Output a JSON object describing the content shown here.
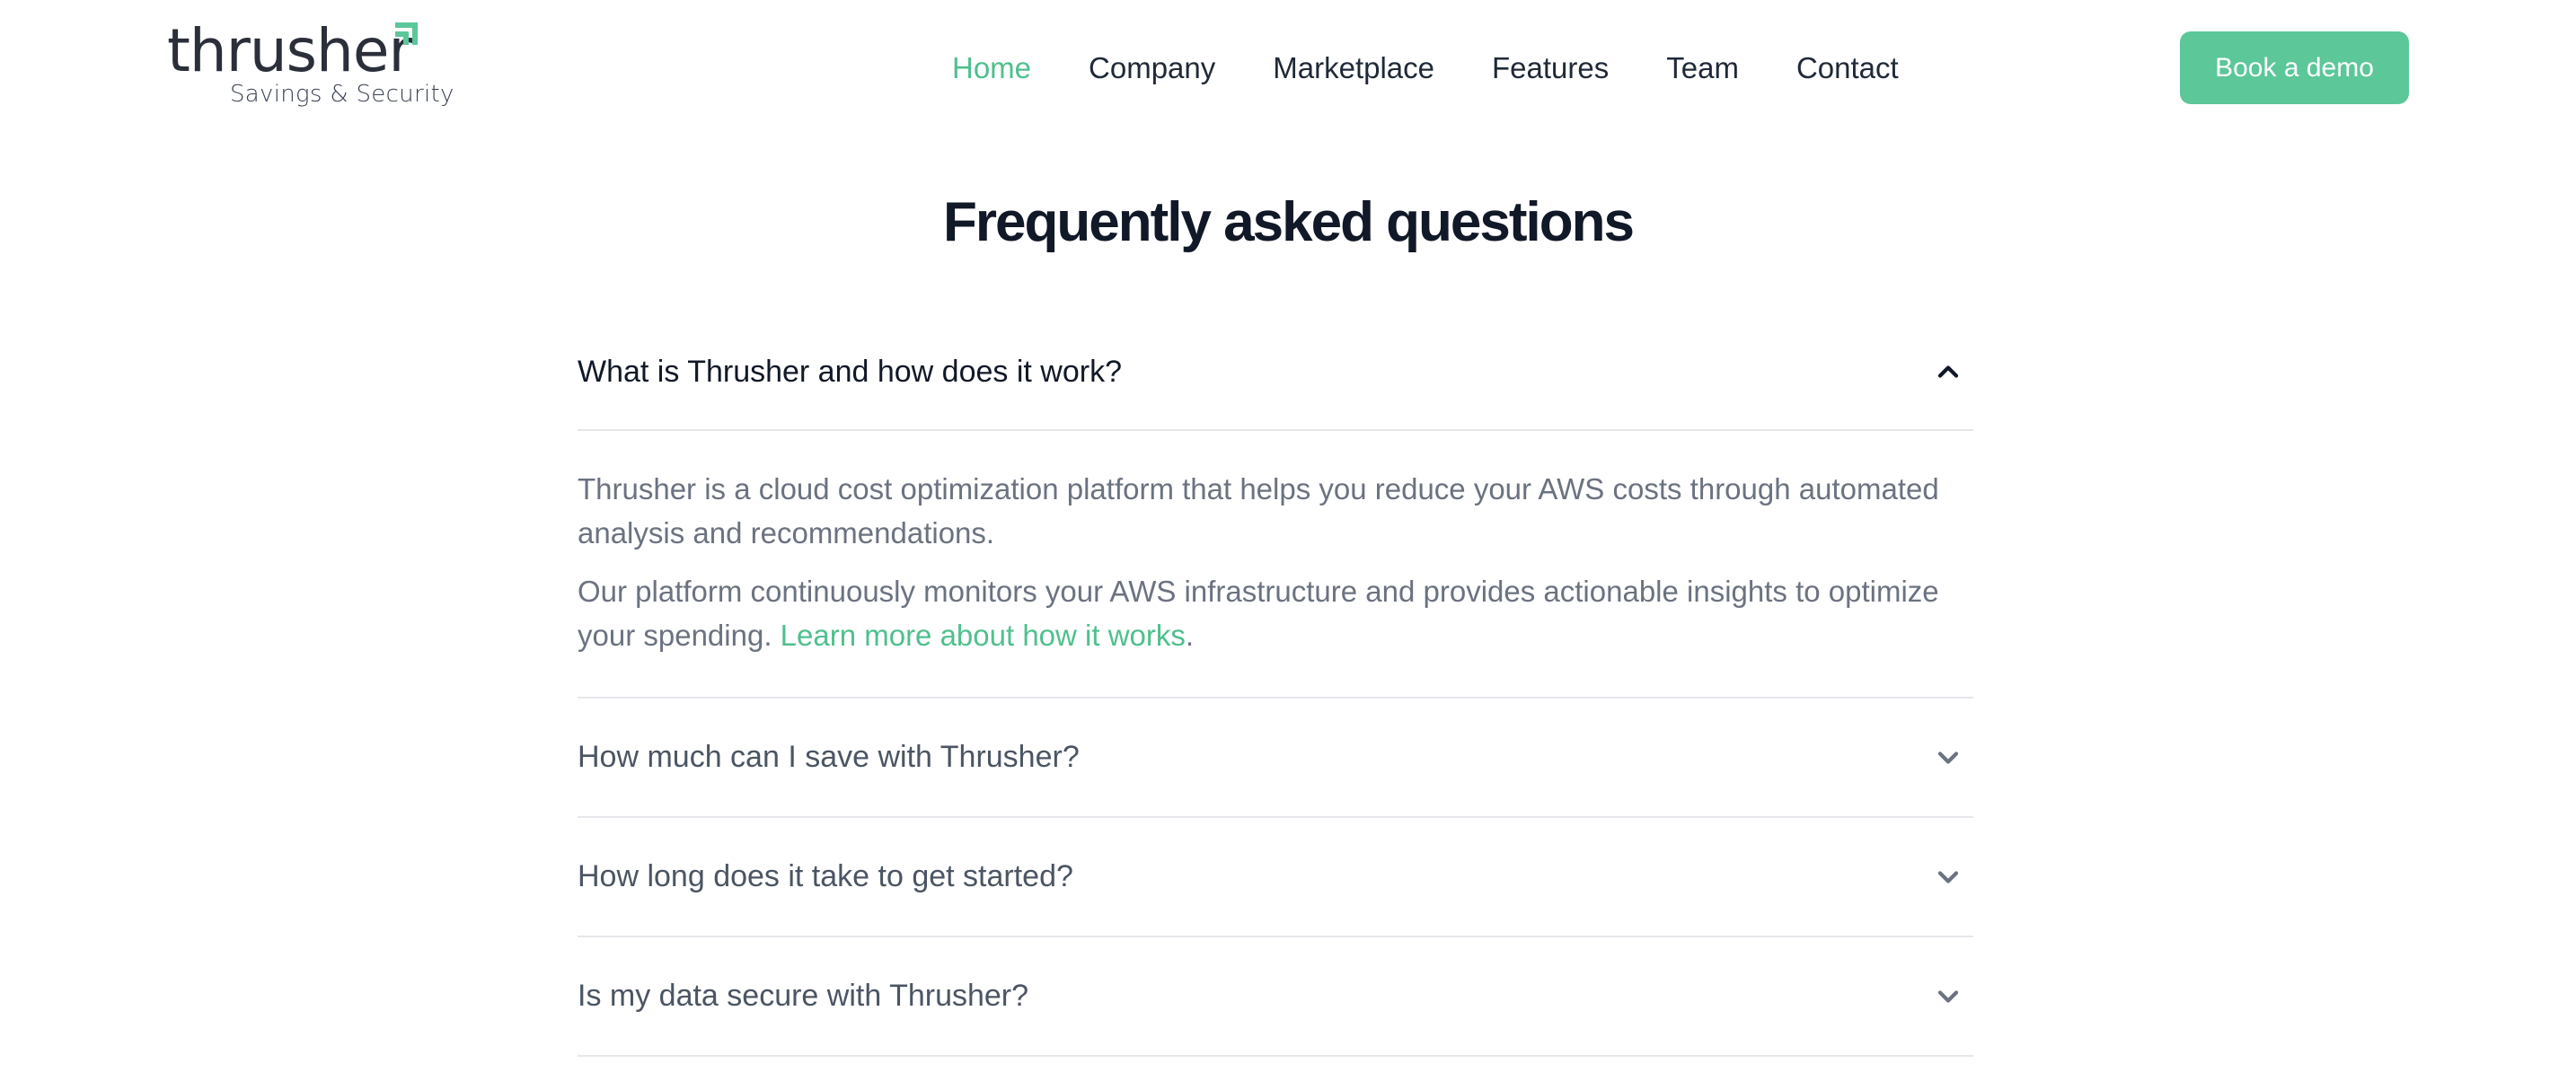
{
  "brand": {
    "name": "thrusher",
    "tagline": "Savings & Security",
    "accent_color": "#4fc08d",
    "button_color": "#5cc799"
  },
  "nav": {
    "items": [
      {
        "label": "Home",
        "active": true
      },
      {
        "label": "Company"
      },
      {
        "label": "Marketplace"
      },
      {
        "label": "Features"
      },
      {
        "label": "Team"
      },
      {
        "label": "Contact"
      }
    ],
    "cta_label": "Book a demo"
  },
  "faq": {
    "title": "Frequently asked questions",
    "items": [
      {
        "question": "What is Thrusher and how does it work?",
        "expanded": true,
        "icon": "chevron-up-icon",
        "answer_p1": "Thrusher is a cloud cost optimization platform that helps you reduce your AWS costs through automated analysis and recommendations.",
        "answer_p2": "Our platform continuously monitors your AWS infrastructure and provides actionable insights to optimize your spending.",
        "answer_link": "Learn more about how it works",
        "answer_end": "."
      },
      {
        "question": "How much can I save with Thrusher?",
        "expanded": false,
        "icon": "chevron-down-icon"
      },
      {
        "question": "How long does it take to get started?",
        "expanded": false,
        "icon": "chevron-down-icon"
      },
      {
        "question": "Is my data secure with Thrusher?",
        "expanded": false,
        "icon": "chevron-down-icon"
      }
    ]
  }
}
